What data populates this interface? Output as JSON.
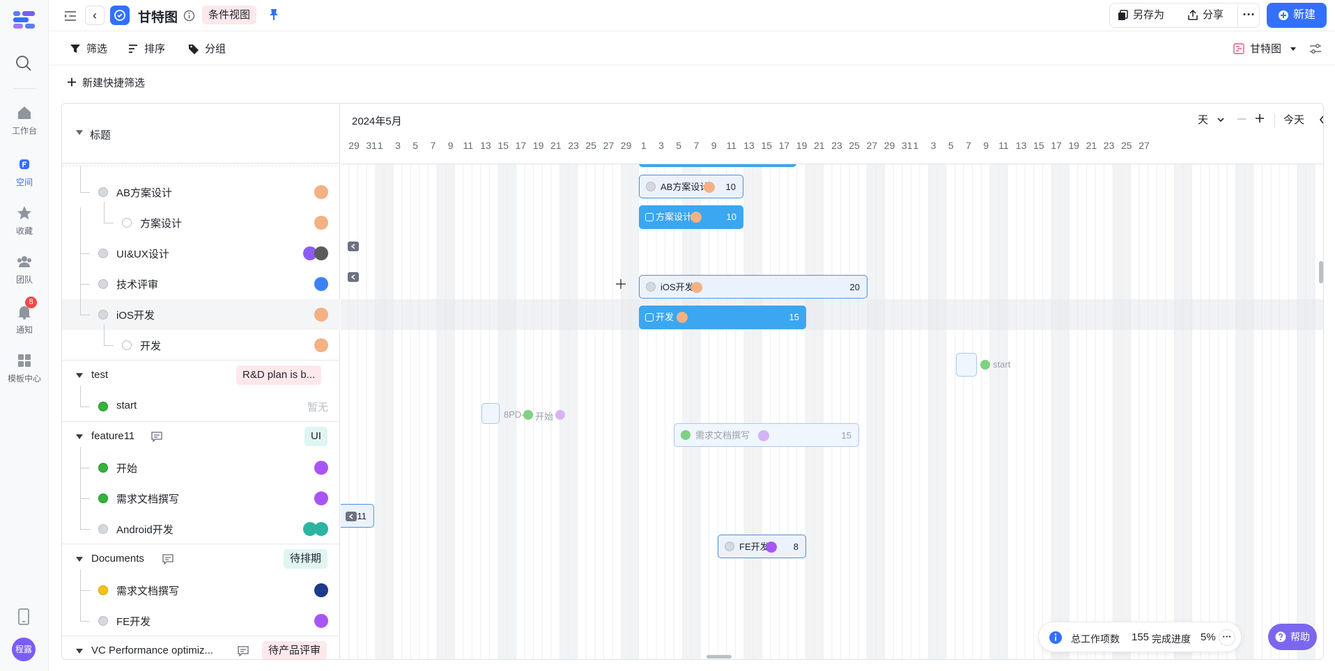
{
  "rail": {
    "nav": [
      {
        "label": "工作台",
        "icon": "home-icon"
      },
      {
        "label": "空间",
        "icon": "space-icon"
      },
      {
        "label": "收藏",
        "icon": "star-icon"
      },
      {
        "label": "团队",
        "icon": "team-icon"
      },
      {
        "label": "通知",
        "icon": "bell-icon",
        "badge": "8"
      },
      {
        "label": "模板中心",
        "icon": "template-icon"
      }
    ],
    "avatar": "程露"
  },
  "topbar": {
    "title": "甘特图",
    "view": "条件视图",
    "save_as": "另存为",
    "share": "分享",
    "new": "新建"
  },
  "toolbar": {
    "filter": "筛选",
    "sort": "排序",
    "group": "分组",
    "view_switch": "甘特图"
  },
  "quick_filter": "新建快捷筛选",
  "table": {
    "header": "标题",
    "rows": [
      {
        "title": "AB方案设计",
        "status": "gray"
      },
      {
        "title": "方案设计",
        "status": "ring"
      },
      {
        "title": "UI&UX设计",
        "status": "gray"
      },
      {
        "title": "技术评审",
        "status": "gray"
      },
      {
        "title": "iOS开发",
        "status": "gray"
      },
      {
        "title": "开发",
        "status": "ring"
      },
      {
        "title": "test",
        "tag": "R&D plan is b..."
      },
      {
        "title": "start",
        "status": "green",
        "empty": "暂无"
      },
      {
        "title": "feature11",
        "tag": "UI"
      },
      {
        "title": "开始",
        "status": "green"
      },
      {
        "title": "需求文档撰写",
        "status": "green"
      },
      {
        "title": "Android开发",
        "status": "gray"
      },
      {
        "title": "Documents",
        "tag": "待排期"
      },
      {
        "title": "需求文档撰写",
        "status": "yellow"
      },
      {
        "title": "FE开发",
        "status": "gray"
      },
      {
        "title": "VC Performance optimiz...",
        "tag": "待产品评审"
      }
    ]
  },
  "gantt": {
    "month": "2024年5月",
    "scale": "天",
    "today": "今天",
    "days": [
      "29",
      "31",
      "1",
      "3",
      "5",
      "7",
      "9",
      "11",
      "13",
      "15",
      "17",
      "19",
      "21",
      "23",
      "25",
      "27",
      "29",
      "1",
      "3",
      "5",
      "7",
      "9",
      "11",
      "13",
      "15",
      "17",
      "19",
      "21",
      "23",
      "25",
      "27",
      "29",
      "31",
      "1",
      "3",
      "5",
      "7",
      "9",
      "11",
      "13",
      "15",
      "17",
      "19",
      "21",
      "23",
      "25",
      "27"
    ],
    "bars": [
      {
        "label": "AB方案设计",
        "value": "10"
      },
      {
        "label": "方案设计",
        "value": "10"
      },
      {
        "label": "iOS开发",
        "value": "20"
      },
      {
        "label": "开发",
        "value": "15"
      },
      {
        "label": "start"
      },
      {
        "label": "8PD-",
        "label2": "开始"
      },
      {
        "label": "需求文档撰写",
        "value": "15"
      },
      {
        "label": "",
        "value": "11"
      },
      {
        "label": "FE开发",
        "value": "8"
      }
    ]
  },
  "summary": {
    "total_label": "总工作项数",
    "total": "155",
    "progress_label": "完成进度",
    "progress": "5%"
  },
  "help": "帮助",
  "colors": {
    "accent": "#3370ff",
    "bar_blue": "#3aa7f0",
    "help": "#7b67ee"
  }
}
